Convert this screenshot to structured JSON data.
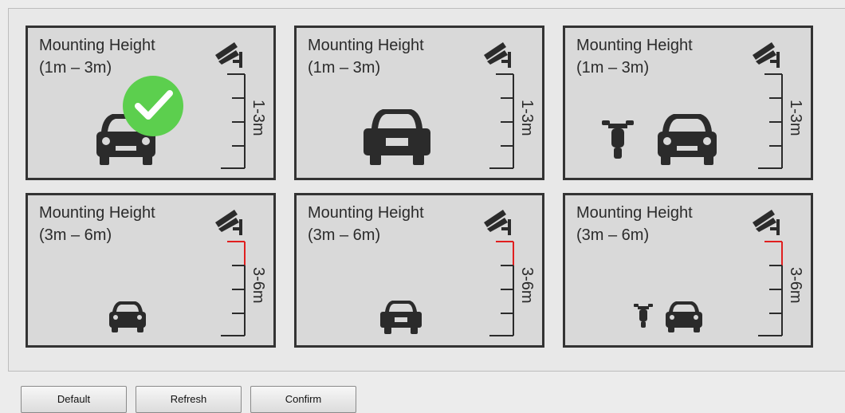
{
  "cards": [
    {
      "title": "Mounting Height",
      "range": "(1m – 3m)",
      "scale": "1-3m",
      "selected": true,
      "vehicles": "car-front"
    },
    {
      "title": "Mounting Height",
      "range": "(1m – 3m)",
      "scale": "1-3m",
      "selected": false,
      "vehicles": "car-rear"
    },
    {
      "title": "Mounting Height",
      "range": "(1m – 3m)",
      "scale": "1-3m",
      "selected": false,
      "vehicles": "moto-car"
    },
    {
      "title": "Mounting Height",
      "range": " (3m – 6m)",
      "scale": "3-6m",
      "selected": false,
      "vehicles": "car-front-small"
    },
    {
      "title": "Mounting Height",
      "range": "(3m – 6m)",
      "scale": "3-6m",
      "selected": false,
      "vehicles": "car-rear-small"
    },
    {
      "title": "Mounting Height",
      "range": "(3m – 6m)",
      "scale": "3-6m",
      "selected": false,
      "vehicles": "moto-car-small"
    }
  ],
  "buttons": {
    "default_label": "Default",
    "refresh_label": "Refresh",
    "confirm_label": "Confirm"
  },
  "colors": {
    "accent_check": "#5ccf4e",
    "scale_highlight": "#e02020",
    "icon": "#2b2b2b"
  }
}
